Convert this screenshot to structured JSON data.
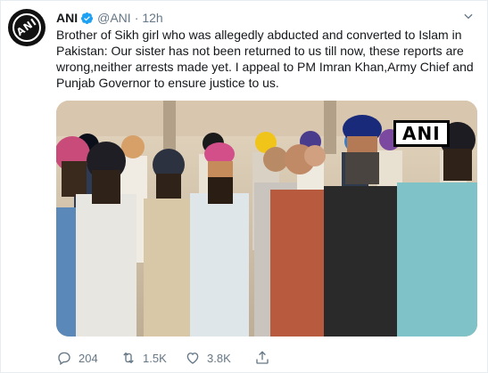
{
  "account": {
    "name": "ANI",
    "handle": "@ANI",
    "separator": "·",
    "time": "12h",
    "avatar_text": "ANI"
  },
  "tweet": {
    "text": "Brother of Sikh girl who was allegedly abducted and converted to Islam in Pakistan: Our sister has not been returned to us till now, these reports are wrong,neither arrests made yet. I appeal to PM Imran Khan,Army Chief and Punjab Governor to ensure justice to us."
  },
  "media": {
    "watermark": "ANI"
  },
  "actions": {
    "reply_count": "204",
    "retweet_count": "1.5K",
    "like_count": "3.8K"
  },
  "colors": {
    "verified": "#1da1f2",
    "muted": "#657786",
    "text": "#14171a"
  },
  "icons": [
    "verified-badge-icon",
    "chevron-down-icon",
    "reply-icon",
    "retweet-icon",
    "like-icon",
    "share-icon"
  ]
}
